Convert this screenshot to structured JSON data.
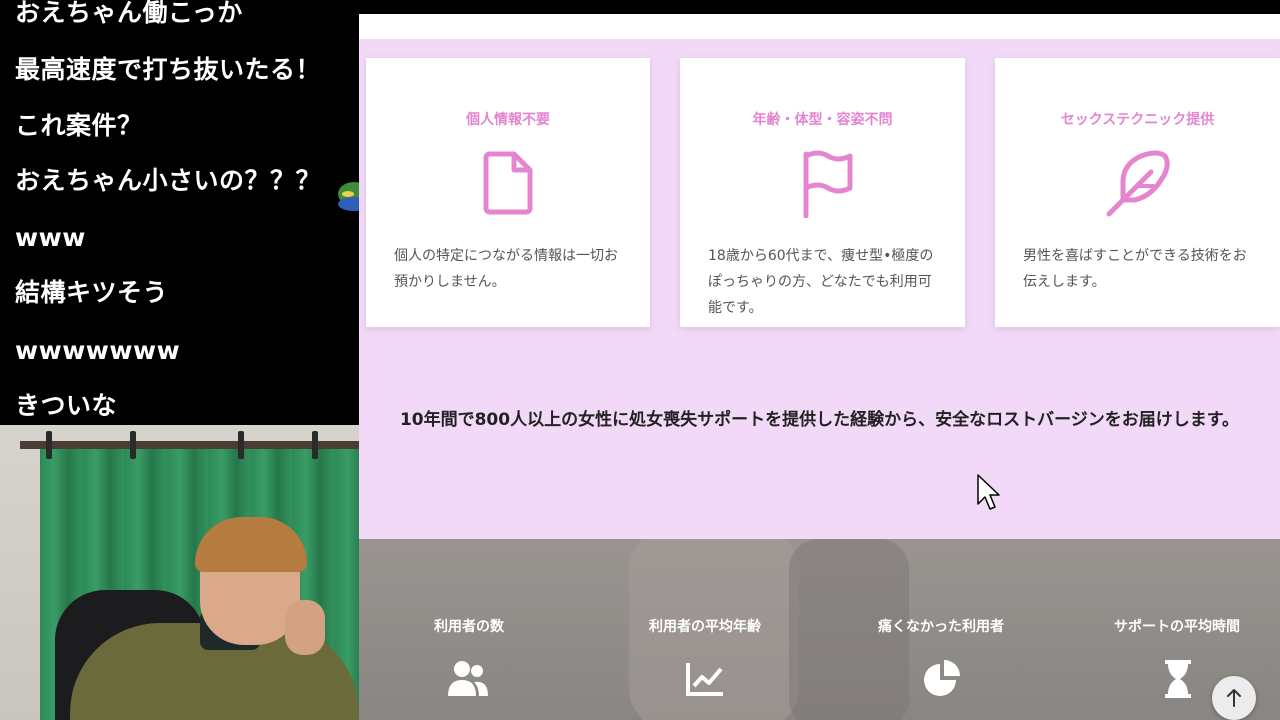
{
  "chat": {
    "messages": [
      "おえちゃん働こっか",
      "最高速度で打ち抜いたる！",
      "これ案件？",
      "おえちゃん小さいの？？？",
      "www",
      "結構キツそう",
      "wwwwwww",
      "きついな"
    ]
  },
  "features": {
    "cards": [
      {
        "title": "個人情報不要",
        "icon": "document-icon",
        "text": "個人の特定につながる情報は一切お預かりしません。"
      },
      {
        "title": "年齢・体型・容姿不問",
        "icon": "flag-icon",
        "text": "18歳から60代まで、痩せ型•極度のぽっちゃりの方、どなたでも利用可能です。"
      },
      {
        "title": "セックステクニック提供",
        "icon": "feather-icon",
        "text": "男性を喜ばすことができる技術をお伝えします。"
      }
    ],
    "lead": "10年間で800人以上の女性に処女喪失サポートを提供した経験から、安全なロストバージンをお届けします。"
  },
  "stats": {
    "items": [
      {
        "label": "利用者の数",
        "icon": "users-icon"
      },
      {
        "label": "利用者の平均年齢",
        "icon": "line-chart-icon"
      },
      {
        "label": "痛くなかった利用者",
        "icon": "pie-chart-icon"
      },
      {
        "label": "サポートの平均時間",
        "icon": "hourglass-icon"
      }
    ]
  },
  "colors": {
    "accent_pink": "#e584cf",
    "section_bg": "#f1d9f7",
    "card_bg": "#ffffff"
  },
  "controls": {
    "scroll_top_icon": "arrow-up-icon"
  }
}
